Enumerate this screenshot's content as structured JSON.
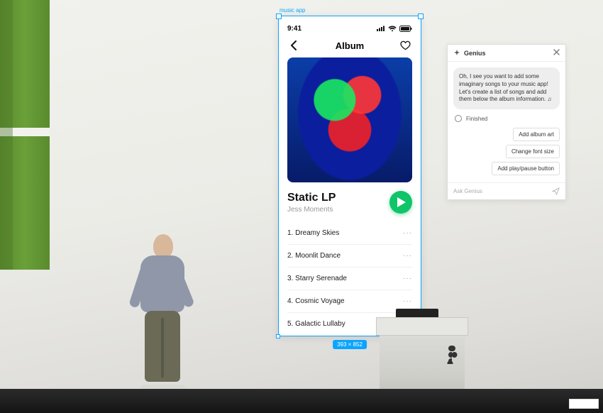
{
  "figma": {
    "frame_label": "music app",
    "frame_dimensions": "393 × 852"
  },
  "phone": {
    "status": {
      "time": "9:41"
    },
    "nav": {
      "title": "Album"
    },
    "album": {
      "title": "Static LP",
      "artist": "Jess Moments"
    },
    "tracks": [
      {
        "label": "1. Dreamy Skies"
      },
      {
        "label": "2. Moonlit Dance"
      },
      {
        "label": "3. Starry Serenade"
      },
      {
        "label": "4. Cosmic Voyage"
      },
      {
        "label": "5. Galactic Lullaby"
      }
    ],
    "more_glyph": "···"
  },
  "genius": {
    "title": "Genius",
    "message": "Oh, I see you want to add some imaginary songs to your music app! Let's create a list of songs and add them below the album information. ♫",
    "status": "Finished",
    "suggestions": [
      "Add album art",
      "Change font size",
      "Add play/pause button"
    ],
    "input_placeholder": "Ask Genius"
  }
}
